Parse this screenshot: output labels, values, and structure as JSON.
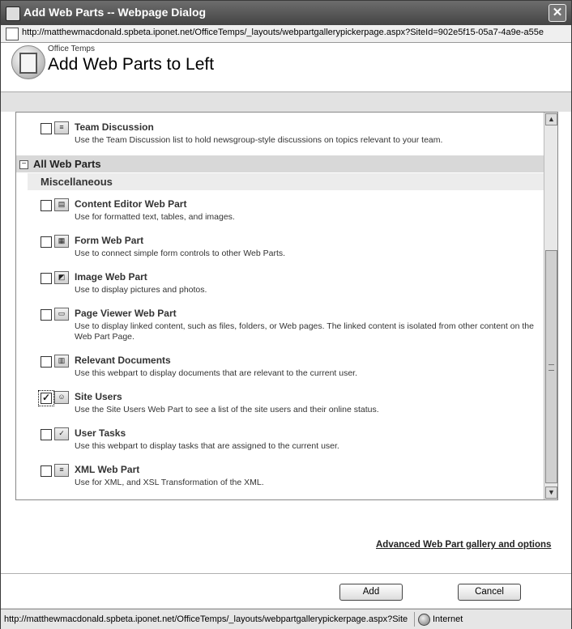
{
  "window": {
    "title": "Add Web Parts -- Webpage Dialog",
    "close_glyph": "✕",
    "address": "http://matthewmacdonald.spbeta.iponet.net/OfficeTemps/_layouts/webpartgallerypickerpage.aspx?SiteId=902e5f15-05a7-4a9e-a55e"
  },
  "header": {
    "site_name": "Office Temps",
    "title": "Add Web Parts to Left"
  },
  "top_item": {
    "title": "Team Discussion",
    "description": "Use the Team Discussion list to hold newsgroup-style discussions on topics relevant to your team.",
    "checked": false,
    "icon": "discussion-icon"
  },
  "group": {
    "toggle": "−",
    "label": "All Web Parts",
    "category": "Miscellaneous",
    "items": [
      {
        "title": "Content Editor Web Part",
        "description": "Use for formatted text, tables, and images.",
        "checked": false,
        "icon": "content-editor-icon"
      },
      {
        "title": "Form Web Part",
        "description": "Use to connect simple form controls to other Web Parts.",
        "checked": false,
        "icon": "form-icon"
      },
      {
        "title": "Image Web Part",
        "description": "Use to display pictures and photos.",
        "checked": false,
        "icon": "image-icon"
      },
      {
        "title": "Page Viewer Web Part",
        "description": "Use to display linked content, such as files, folders, or Web pages. The linked content is isolated from other content on the Web Part Page.",
        "checked": false,
        "icon": "page-viewer-icon"
      },
      {
        "title": "Relevant Documents",
        "description": "Use this webpart to display documents that are relevant to the current user.",
        "checked": false,
        "icon": "documents-icon"
      },
      {
        "title": "Site Users",
        "description": "Use the Site Users Web Part to see a list of the site users and their online status.",
        "checked": true,
        "icon": "users-icon"
      },
      {
        "title": "User Tasks",
        "description": "Use this webpart to display tasks that are assigned to the current user.",
        "checked": false,
        "icon": "tasks-icon"
      },
      {
        "title": "XML Web Part",
        "description": "Use for XML, and XSL Transformation of the XML.",
        "checked": false,
        "icon": "xml-icon"
      }
    ]
  },
  "scrollbar": {
    "up": "▲",
    "down": "▼"
  },
  "advanced_link": "Advanced Web Part gallery and options",
  "buttons": {
    "add": "Add",
    "cancel": "Cancel"
  },
  "status": {
    "url": "http://matthewmacdonald.spbeta.iponet.net/OfficeTemps/_layouts/webpartgallerypickerpage.aspx?Site",
    "zone": "Internet"
  }
}
